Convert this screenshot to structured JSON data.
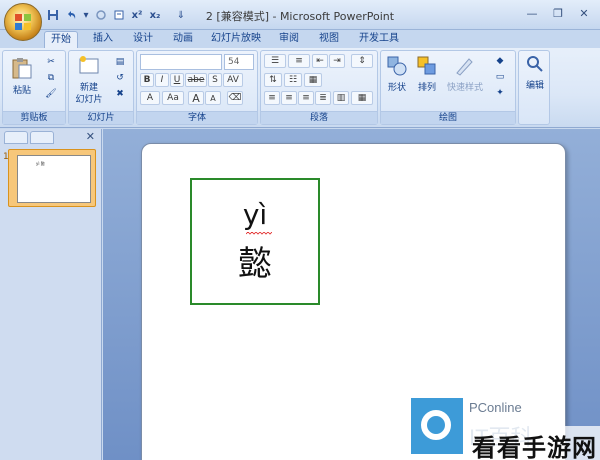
{
  "window": {
    "title": "2 [兼容模式] - Microsoft PowerPoint"
  },
  "quick_access": {
    "icons": [
      "save-icon",
      "undo-icon",
      "redo-icon",
      "customize-icon"
    ],
    "format_glyphs": [
      "x²",
      "x₂",
      "⇐",
      "="
    ]
  },
  "tabs": [
    "开始",
    "插入",
    "设计",
    "动画",
    "幻灯片放映",
    "审阅",
    "视图",
    "开发工具"
  ],
  "active_tab": "开始",
  "ribbon": {
    "clipboard": {
      "paste_label": "粘贴",
      "group_label": "剪贴板"
    },
    "slides": {
      "new_slide_label_1": "新建",
      "new_slide_label_2": "幻灯片",
      "group_label": "幻灯片"
    },
    "font": {
      "font_name": "",
      "font_size": "54",
      "bold": "B",
      "italic": "I",
      "underline": "U",
      "strike": "abe",
      "shadow": "S",
      "spacing": "AV",
      "change_case": "Aa",
      "grow": "A",
      "shrink": "A",
      "group_label": "字体"
    },
    "paragraph": {
      "group_label": "段落"
    },
    "drawing": {
      "shapes_label": "形状",
      "arrange_label": "排列",
      "quick_styles_label": "快速样式",
      "group_label": "绘图"
    },
    "editing": {
      "label": "编辑"
    }
  },
  "slide_panel": {
    "slide_number": "1",
    "thumb_text": "yì 懿"
  },
  "slide": {
    "pinyin": "yì",
    "hanzi": "懿"
  },
  "watermarks": {
    "pconline_text": "PConline",
    "pconline_cn": "IT百科",
    "site_text": "看看手游网"
  },
  "colors": {
    "box_border": "#2a8a2a",
    "ribbon_bg": "#dbe7f7",
    "accent_tab": "#e7effa"
  }
}
